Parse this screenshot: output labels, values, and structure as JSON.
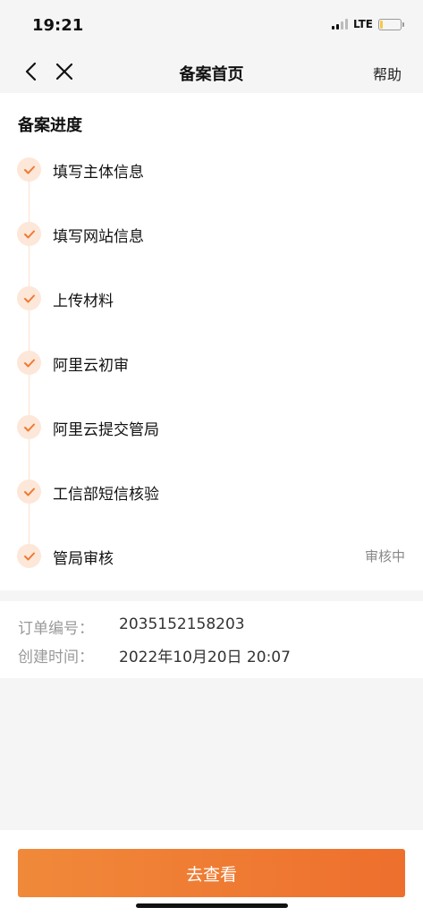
{
  "status_bar": {
    "time": "19:21",
    "network": "LTE",
    "battery_level": 0.15
  },
  "nav": {
    "title": "备案首页",
    "help_label": "帮助",
    "back_icon": "chevron-left-icon",
    "close_icon": "close-icon"
  },
  "progress": {
    "title": "备案进度",
    "steps": [
      {
        "label": "填写主体信息",
        "status": ""
      },
      {
        "label": "填写网站信息",
        "status": ""
      },
      {
        "label": "上传材料",
        "status": ""
      },
      {
        "label": "阿里云初审",
        "status": ""
      },
      {
        "label": "阿里云提交管局",
        "status": ""
      },
      {
        "label": "工信部短信核验",
        "status": ""
      },
      {
        "label": "管局审核",
        "status": "审核中"
      }
    ]
  },
  "order": {
    "number_label": "订单编号：",
    "number_value": "2035152158203",
    "created_label": "创建时间：",
    "created_value": "2022年10月20日 20:07"
  },
  "action": {
    "button_label": "去查看"
  },
  "colors": {
    "accent": "#f0893a",
    "accent_light": "#fde7d9"
  }
}
